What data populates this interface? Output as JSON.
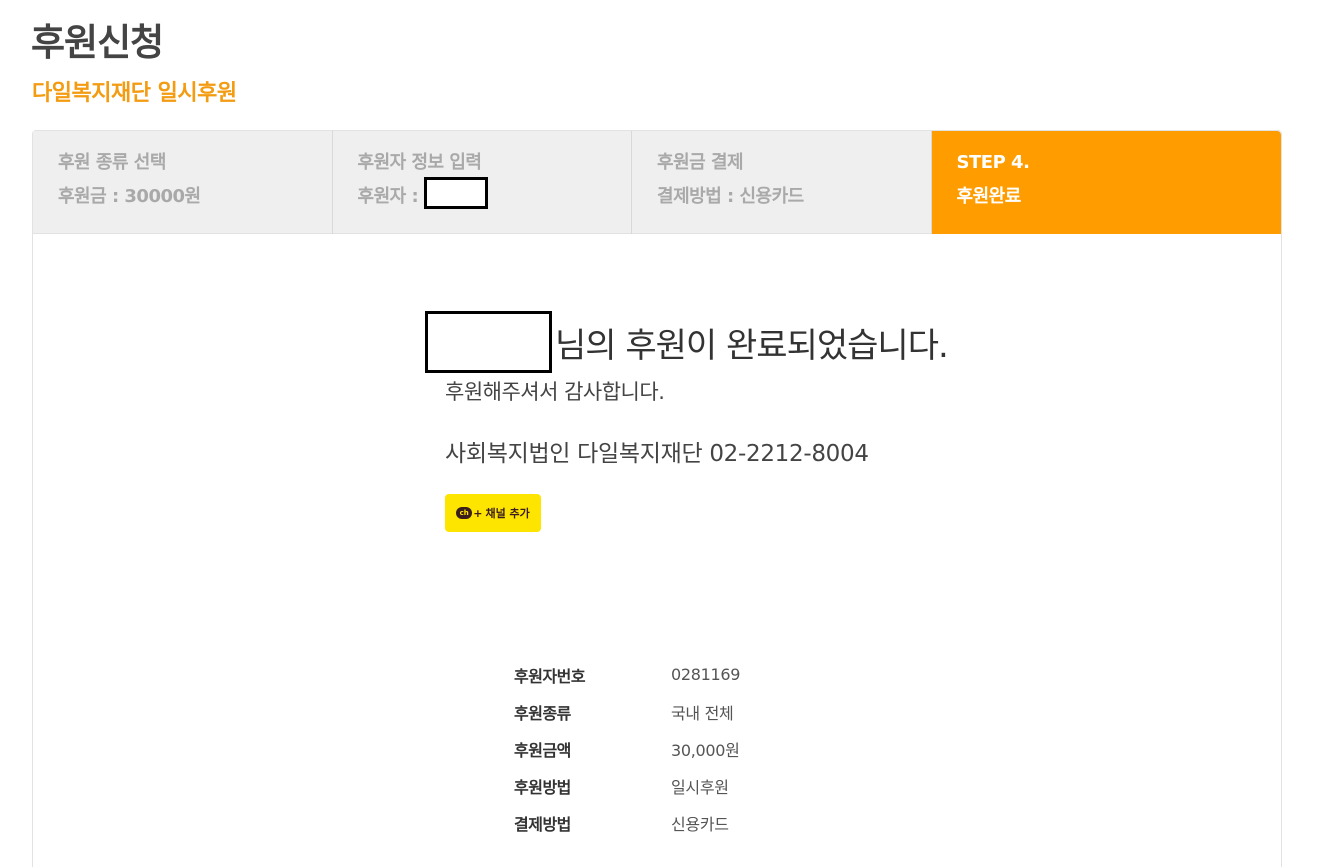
{
  "page": {
    "title": "후원신청",
    "subtitle": "다일복지재단 일시후원"
  },
  "steps": [
    {
      "title": "후원 종류 선택",
      "detail": "후원금 : 30000원",
      "active": false
    },
    {
      "title": "후원자 정보 입력",
      "detail": "후원자 : ",
      "active": false
    },
    {
      "title": "후원금 결제",
      "detail": "결제방법 : 신용카드",
      "active": false
    },
    {
      "title": "STEP 4.",
      "detail": "후원완료",
      "active": true
    }
  ],
  "completion": {
    "heading": "님의 후원이 완료되었습니다.",
    "thanks": "후원해주셔서 감사합니다.",
    "contact": "사회복지법인 다일복지재단 02-2212-8004"
  },
  "channel_button": {
    "icon_text": "ch",
    "plus": "+",
    "label": "채널 추가"
  },
  "details": [
    {
      "label": "후원자번호",
      "value": "0281169"
    },
    {
      "label": "후원종류",
      "value": "국내 전체"
    },
    {
      "label": "후원금액",
      "value": "30,000원"
    },
    {
      "label": "후원방법",
      "value": "일시후원"
    },
    {
      "label": "결제방법",
      "value": "신용카드"
    }
  ],
  "colors": {
    "accent": "#f39c12",
    "active_step": "#ff9c00",
    "step_bg": "#efefef",
    "kakao_yellow": "#fee500"
  }
}
